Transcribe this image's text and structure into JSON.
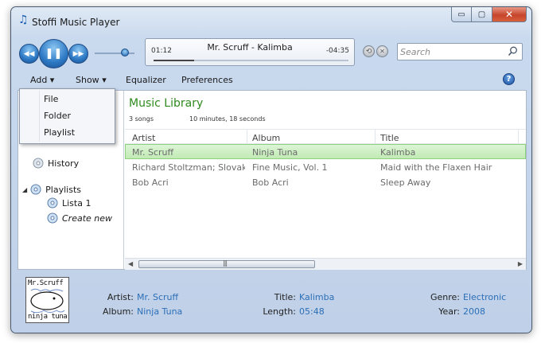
{
  "window": {
    "title": "Stoffi Music Player",
    "caption_min": "▭",
    "caption_max": "▢",
    "caption_close": "✕"
  },
  "transport": {
    "prev_glyph": "◀◀",
    "play_pause_glyph": "❚❚",
    "next_glyph": "▶▶",
    "volume_level": 0.75
  },
  "now_playing": {
    "title": "Mr. Scruff - Kalimba",
    "elapsed": "01:12",
    "remaining": "-04:35",
    "progress": 0.21
  },
  "search": {
    "placeholder": "Search"
  },
  "menu": {
    "add": "Add",
    "show": "Show",
    "equalizer": "Equalizer",
    "preferences": "Preferences",
    "help_glyph": "?"
  },
  "add_menu": {
    "items": [
      "File",
      "Folder",
      "Playlist"
    ]
  },
  "sidebar": {
    "history": "History",
    "playlists": "Playlists",
    "playlist_items": [
      "Lista 1"
    ],
    "create_new": "Create new"
  },
  "library": {
    "title": "Music Library",
    "song_count": "3 songs",
    "duration": "10 minutes, 18 seconds",
    "columns": [
      "Artist",
      "Album",
      "Title"
    ],
    "rows": [
      {
        "artist": "Mr. Scruff",
        "album": "Ninja Tuna",
        "title": "Kalimba"
      },
      {
        "artist": "Richard Stoltzman; Slovak R...",
        "album": "Fine Music, Vol. 1",
        "title": "Maid with the Flaxen Hair"
      },
      {
        "artist": "Bob Acri",
        "album": "Bob Acri",
        "title": "Sleep Away"
      }
    ],
    "selected_row": 0,
    "scroll_left": "◀",
    "scroll_right": "▶",
    "scroll_grip": "|||"
  },
  "details": {
    "art_text_top": "Mr.Scruff",
    "art_text_bottom": "ninja tuna",
    "artist_label": "Artist:",
    "artist": "Mr. Scruff",
    "album_label": "Album:",
    "album": "Ninja Tuna",
    "title_label": "Title:",
    "title": "Kalimba",
    "length_label": "Length:",
    "length": "05:48",
    "genre_label": "Genre:",
    "genre": "Electronic",
    "year_label": "Year:",
    "year": "2008"
  },
  "colors": {
    "accent": "#2c6fb7",
    "library_title": "#2f8a1e",
    "selection": "#c1eab4"
  }
}
